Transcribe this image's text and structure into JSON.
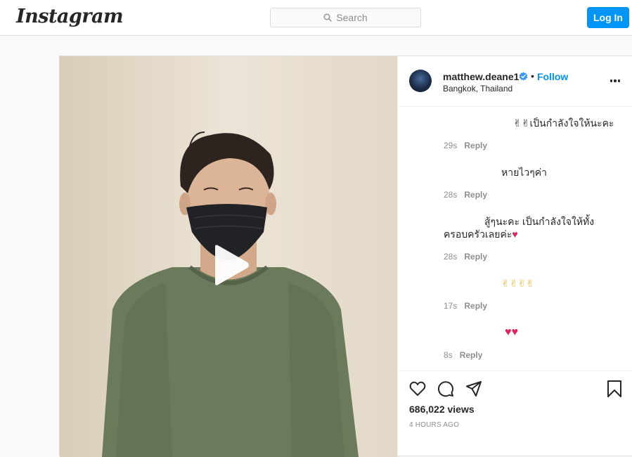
{
  "header": {
    "logo_text": "Instagram",
    "search_placeholder": "Search",
    "login_label": "Log In"
  },
  "post": {
    "username": "matthew.deane1",
    "follow_label": "Follow",
    "separator": "•",
    "location": "Bangkok, Thailand",
    "comments": [
      {
        "text": "✌✌เป็นกำลังใจให้นะคะ",
        "age": "29s",
        "reply": "Reply"
      },
      {
        "text": "หายไวๆค่า",
        "age": "28s",
        "reply": "Reply"
      },
      {
        "text_line1": "สู้ๆนะคะ เป็นกำลังใจให้ทั้ง",
        "text_line2": "ครอบครัวเลยค่ะ",
        "heart": "♥",
        "age": "28s",
        "reply": "Reply"
      },
      {
        "text": "✌✌✌✌",
        "age": "17s",
        "reply": "Reply"
      },
      {
        "text": "♥♥",
        "age": "8s",
        "reply": "Reply"
      }
    ],
    "views": "686,022 views",
    "posted_ago": "4 HOURS AGO"
  },
  "colors": {
    "accent": "#0095f6",
    "verified": "#3897f0",
    "heart": "#e0245e"
  }
}
